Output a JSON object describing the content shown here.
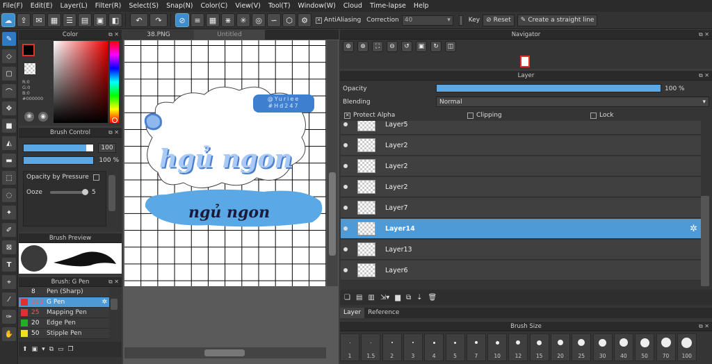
{
  "menu": [
    "File(F)",
    "Edit(E)",
    "Layer(L)",
    "Filter(R)",
    "Select(S)",
    "Snap(N)",
    "Color(C)",
    "View(V)",
    "Tool(T)",
    "Window(W)",
    "Cloud",
    "Time-lapse",
    "Help"
  ],
  "toolbar": {
    "antialiasing_label": "AntiAliasing",
    "correction_label": "Correction",
    "correction_value": "40",
    "key_label": "Key",
    "reset_label": "Reset",
    "straight_line_label": "Create a straight line"
  },
  "color_panel": {
    "title": "Color",
    "r": "R:0",
    "g": "G:0",
    "b": "B:0",
    "hex": "#000000"
  },
  "brush_control": {
    "title": "Brush Control",
    "size_value": "100",
    "opacity_value": "100 %",
    "opacity_by_pressure_label": "Opacity by Pressure",
    "ooze_label": "Ooze",
    "ooze_value": "5"
  },
  "brush_preview": {
    "title": "Brush Preview"
  },
  "brush_list": {
    "title": "Brush: G Pen",
    "items": [
      {
        "size": "8",
        "name": "Pen (Sharp)",
        "color": "#000000"
      },
      {
        "size": "100",
        "name": "G Pen",
        "color": "#e03030"
      },
      {
        "size": "25",
        "name": "Mapping Pen",
        "color": "#e03030"
      },
      {
        "size": "20",
        "name": "Edge Pen",
        "color": "#20b020"
      },
      {
        "size": "50",
        "name": "Stipple Pen",
        "color": "#f0e020"
      }
    ]
  },
  "tabs": {
    "tab1": "38.PNG",
    "tab2": "Untitled"
  },
  "canvas": {
    "watermark_line1": "@Yuriee",
    "watermark_line2": "#Hd247",
    "title_text": "hgủ ngon",
    "subtitle_text": "ngủ ngon"
  },
  "navigator": {
    "title": "Navigator"
  },
  "layer_panel": {
    "title": "Layer",
    "opacity_label": "Opacity",
    "opacity_value": "100 %",
    "opacity_fraction": 1.0,
    "blending_label": "Blending",
    "blending_value": "Normal",
    "protect_alpha_label": "Protect Alpha",
    "clipping_label": "Clipping",
    "lock_label": "Lock",
    "layers": [
      "Layer5",
      "Layer2",
      "Layer2",
      "Layer2",
      "Layer7",
      "Layer14",
      "Layer13",
      "Layer6"
    ],
    "selected_index": 5
  },
  "bottom_tabs": {
    "layer": "Layer",
    "reference": "Reference"
  },
  "brush_size": {
    "title": "Brush Size",
    "sizes": [
      "1",
      "1.5",
      "2",
      "3",
      "4",
      "5",
      "7",
      "10",
      "12",
      "15",
      "20",
      "25",
      "30",
      "40",
      "50",
      "70",
      "100"
    ]
  }
}
